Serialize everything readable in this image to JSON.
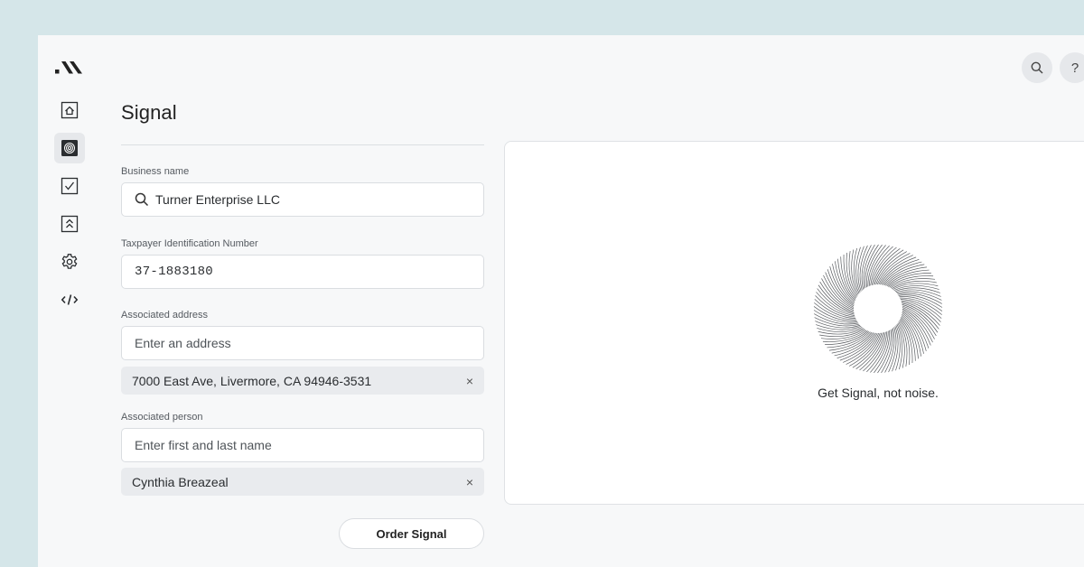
{
  "header": {
    "title": "Signal",
    "search_icon": "search-icon",
    "help_label": "?"
  },
  "sidebar": {
    "items": [
      {
        "name": "home",
        "icon": "home-icon"
      },
      {
        "name": "signal",
        "icon": "signal-icon",
        "active": true
      },
      {
        "name": "tasks",
        "icon": "checkbox-icon"
      },
      {
        "name": "reports",
        "icon": "chevrons-up-icon"
      },
      {
        "name": "settings",
        "icon": "gear-icon"
      },
      {
        "name": "developer",
        "icon": "code-icon"
      }
    ]
  },
  "form": {
    "business_name_label": "Business name",
    "business_name_value": "Turner Enterprise LLC",
    "tin_label": "Taxpayer Identification Number",
    "tin_value": "37-1883180",
    "address_label": "Associated address",
    "address_placeholder": "Enter an address",
    "address_chip": "7000 East Ave, Livermore, CA 94946-3531",
    "person_label": "Associated person",
    "person_placeholder": "Enter first and last name",
    "person_chip": "Cynthia Breazeal",
    "remove_symbol": "×",
    "order_button": "Order Signal"
  },
  "panel": {
    "tagline": "Get Signal, not noise."
  }
}
